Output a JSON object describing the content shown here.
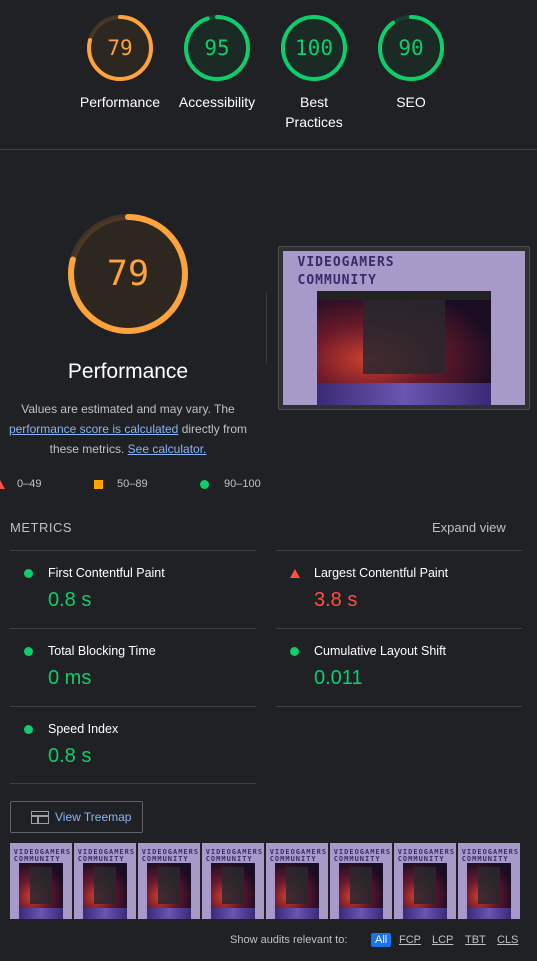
{
  "colors": {
    "average": "#ffa33c",
    "pass": "#0cce6b",
    "fail": "#ff4e42",
    "link": "#8ab4f8",
    "background": "#202124"
  },
  "gauges": [
    {
      "score": 79,
      "label": "Performance",
      "color": "#ffa33c"
    },
    {
      "score": 95,
      "label": "Accessibility",
      "color": "#0cce6b"
    },
    {
      "score": 100,
      "label": "Best Practices",
      "color": "#0cce6b"
    },
    {
      "score": 90,
      "label": "SEO",
      "color": "#0cce6b"
    }
  ],
  "performance": {
    "score": 79,
    "title": "Performance",
    "desc_prefix": "Values are estimated and may vary. The",
    "desc_link": "performance score is calculated",
    "desc_middle": "directly from these metrics.",
    "calc_link": "See calculator."
  },
  "screenshot": {
    "title_line1": "VIDEOGAMERS",
    "title_line2": "COMMUNITY"
  },
  "legend": [
    {
      "icon": "fail-triangle-icon",
      "range": "0–49"
    },
    {
      "icon": "average-square-icon",
      "range": "50–89"
    },
    {
      "icon": "pass-circle-icon",
      "range": "90–100"
    }
  ],
  "metrics": {
    "heading": "METRICS",
    "expand_label": "Expand view",
    "items": [
      {
        "name": "First Contentful Paint",
        "value": "0.8 s",
        "status": "pass"
      },
      {
        "name": "Largest Contentful Paint",
        "value": "3.8 s",
        "status": "fail"
      },
      {
        "name": "Total Blocking Time",
        "value": "0 ms",
        "status": "pass"
      },
      {
        "name": "Cumulative Layout Shift",
        "value": "0.011",
        "status": "pass"
      },
      {
        "name": "Speed Index",
        "value": "0.8 s",
        "status": "pass"
      }
    ]
  },
  "treemap": {
    "label": "View Treemap",
    "icon": "treemap-icon"
  },
  "filmstrip_frames": 8,
  "audit_filter": {
    "label": "Show audits relevant to:",
    "chips": [
      "All",
      "FCP",
      "LCP",
      "TBT",
      "CLS"
    ],
    "active": "All"
  }
}
